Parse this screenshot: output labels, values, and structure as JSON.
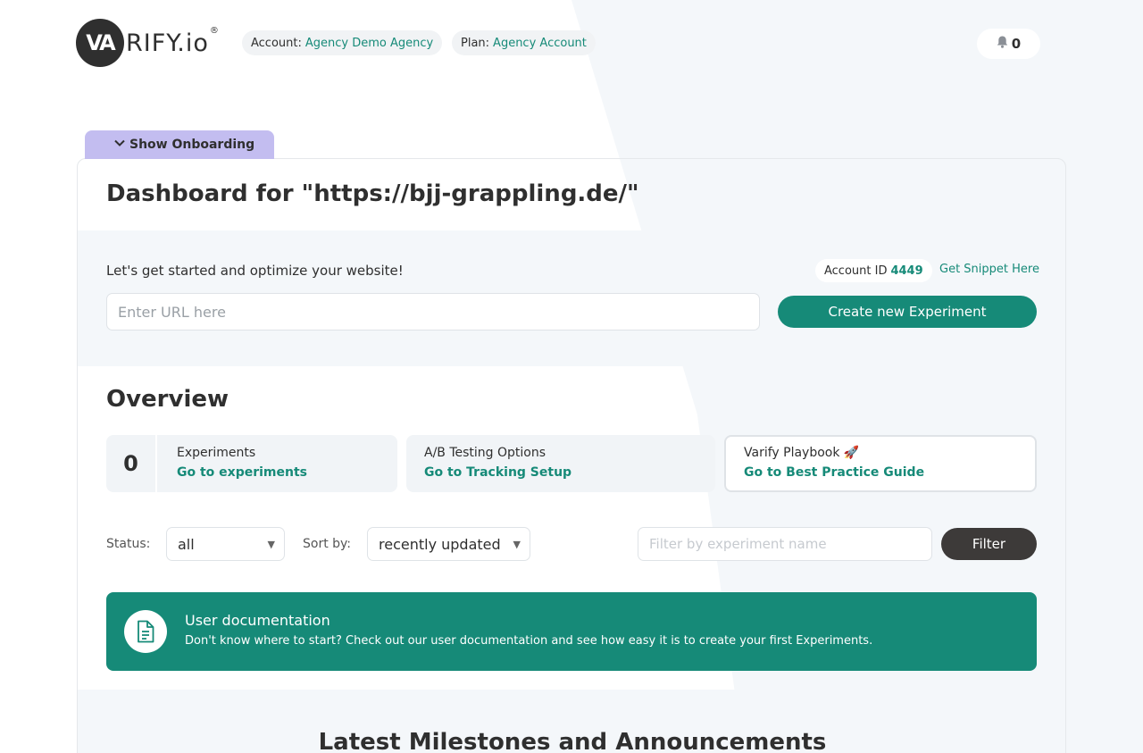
{
  "header": {
    "logo_mark": "VA",
    "logo_text": "RIFY.io",
    "logo_reg": "®",
    "account_label": "Account:",
    "account_value": "Agency Demo Agency",
    "plan_label": "Plan:",
    "plan_value": "Agency Account",
    "notifications_count": "0"
  },
  "onboarding": {
    "label": "Show Onboarding"
  },
  "dashboard": {
    "title": "Dashboard for \"https://bjj-grappling.de/\""
  },
  "start": {
    "text": "Let's get started and optimize your website!",
    "account_id_label": "Account ID",
    "account_id_value": "4449",
    "snippet_link": "Get Snippet Here",
    "url_placeholder": "Enter URL here",
    "create_button": "Create new Experiment"
  },
  "overview": {
    "title": "Overview",
    "cards": [
      {
        "count": "0",
        "title": "Experiments",
        "link": "Go to experiments"
      },
      {
        "title": "A/B Testing Options",
        "link": "Go to Tracking Setup"
      },
      {
        "title": "Varify Playbook 🚀",
        "link": "Go to Best Practice Guide"
      }
    ]
  },
  "filters": {
    "status_label": "Status:",
    "status_value": "all",
    "sort_label": "Sort by:",
    "sort_value": "recently updated",
    "name_placeholder": "Filter by experiment name",
    "filter_button": "Filter"
  },
  "doc_banner": {
    "title": "User documentation",
    "text": "Don't know where to start? Check out our user documentation and see how easy it is to create your first Experiments."
  },
  "milestones": {
    "title": "Latest Milestones and Announcements"
  },
  "colors": {
    "accent": "#168a78",
    "onboarding": "#c3bdf0",
    "dark_button": "#3d3a39",
    "section_bg": "#f4f7fa"
  }
}
